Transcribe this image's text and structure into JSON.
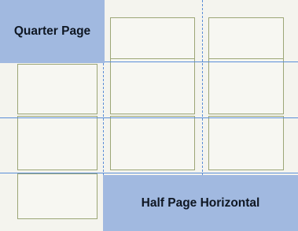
{
  "diagram": {
    "layout_blocks": [
      {
        "id": "quarter",
        "label": "Quarter Page"
      },
      {
        "id": "half",
        "label": "Half Page Horizontal"
      }
    ],
    "colors": {
      "background": "#f4f4ee",
      "panel_border": "#9ca676",
      "panel_fill": "#f7f7f2",
      "guide": "#5b8ed8",
      "block_fill": "#a1b9e0",
      "block_text": "#0f1723"
    }
  }
}
